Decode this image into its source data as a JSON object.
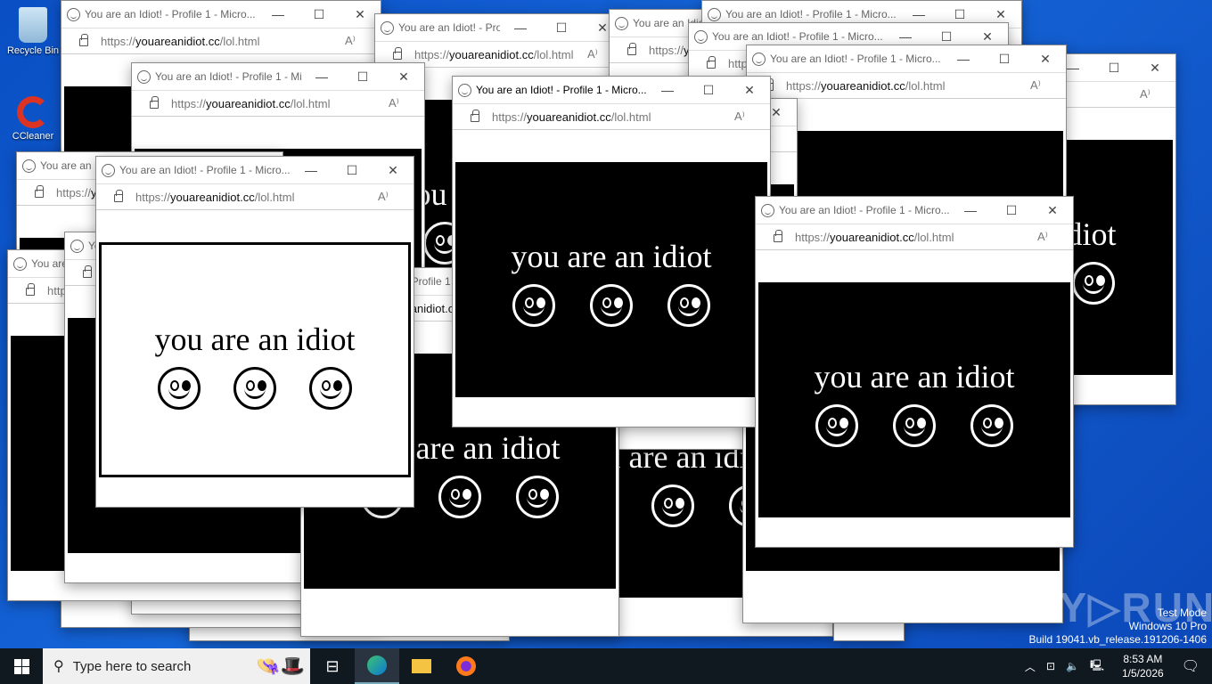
{
  "desktop": {
    "icons": [
      {
        "label": "Recycle Bin"
      },
      {
        "label": "CCleaner"
      }
    ]
  },
  "popup": {
    "title": "You are an Idiot! - Profile 1 - Micro...",
    "url_prefix": "https://",
    "url_domain": "youareanidiot.cc",
    "url_path": "/lol.html",
    "page_text": "you are an idiot",
    "minimize": "—",
    "maximize": "☐",
    "close": "✕",
    "read_aloud": "A⁾"
  },
  "taskbar": {
    "search_placeholder": "Type here to search",
    "time": "8:53 AM",
    "date": "1/5/2026"
  },
  "watermark": {
    "brand": "ANY▷RUN",
    "line1": "Test Mode",
    "line2": "Windows 10 Pro",
    "line3": "Build 19041.vb_release.191206-1406"
  }
}
